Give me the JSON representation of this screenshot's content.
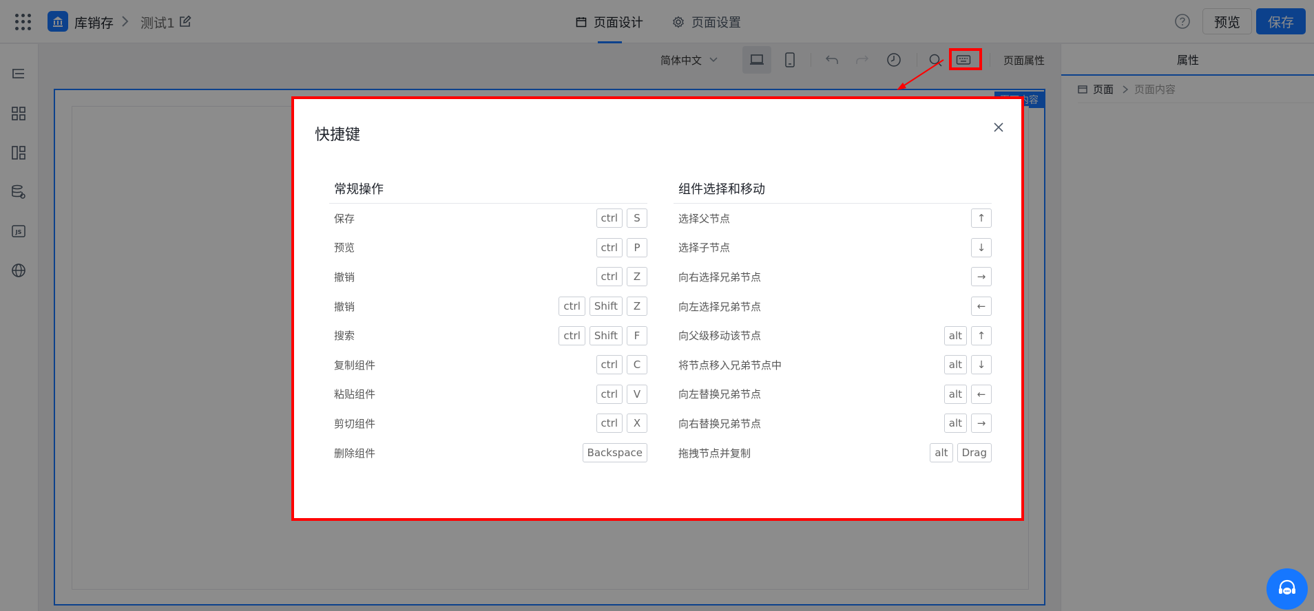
{
  "header": {
    "app_name": "库销存",
    "page_name": "测试1",
    "tabs": [
      {
        "label": "页面设计",
        "active": true
      },
      {
        "label": "页面设置",
        "active": false
      }
    ],
    "preview_label": "预览",
    "save_label": "保存"
  },
  "left_rail": {
    "icons": [
      "outline-tree-icon",
      "components-grid-icon",
      "layout-icon",
      "datasource-icon",
      "js-code-icon",
      "globe-icon"
    ]
  },
  "toolbar": {
    "language": "简体中文",
    "page_props_label": "页面属性"
  },
  "canvas": {
    "page_tag": "页面内容"
  },
  "right_panel": {
    "title": "属性",
    "breadcrumb": [
      "页面",
      "页面内容"
    ]
  },
  "modal": {
    "title": "快捷键",
    "left_section": {
      "title": "常规操作",
      "rows": [
        {
          "label": "保存",
          "keys": [
            "ctrl",
            "S"
          ]
        },
        {
          "label": "预览",
          "keys": [
            "ctrl",
            "P"
          ]
        },
        {
          "label": "撤销",
          "keys": [
            "ctrl",
            "Z"
          ]
        },
        {
          "label": "撤销",
          "keys": [
            "ctrl",
            "Shift",
            "Z"
          ]
        },
        {
          "label": "搜索",
          "keys": [
            "ctrl",
            "Shift",
            "F"
          ]
        },
        {
          "label": "复制组件",
          "keys": [
            "ctrl",
            "C"
          ]
        },
        {
          "label": "粘贴组件",
          "keys": [
            "ctrl",
            "V"
          ]
        },
        {
          "label": "剪切组件",
          "keys": [
            "ctrl",
            "X"
          ]
        },
        {
          "label": "删除组件",
          "keys": [
            "Backspace"
          ]
        }
      ]
    },
    "right_section": {
      "title": "组件选择和移动",
      "rows": [
        {
          "label": "选择父节点",
          "keys": [
            "↑"
          ]
        },
        {
          "label": "选择子节点",
          "keys": [
            "↓"
          ]
        },
        {
          "label": "向右选择兄弟节点",
          "keys": [
            "→"
          ]
        },
        {
          "label": "向左选择兄弟节点",
          "keys": [
            "←"
          ]
        },
        {
          "label": "向父级移动该节点",
          "keys": [
            "alt",
            "↑"
          ]
        },
        {
          "label": "将节点移入兄弟节点中",
          "keys": [
            "alt",
            "↓"
          ]
        },
        {
          "label": "向左替换兄弟节点",
          "keys": [
            "alt",
            "←"
          ]
        },
        {
          "label": "向右替换兄弟节点",
          "keys": [
            "alt",
            "→"
          ]
        },
        {
          "label": "拖拽节点并复制",
          "keys": [
            "alt",
            "Drag"
          ]
        }
      ]
    }
  },
  "colors": {
    "accent": "#1677ff",
    "annotation": "#ff0000"
  }
}
